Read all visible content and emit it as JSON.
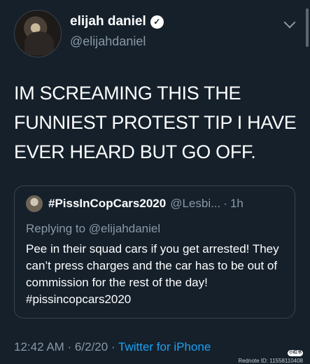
{
  "author": {
    "display_name": "elijah daniel",
    "handle": "@elijahdaniel"
  },
  "tweet": {
    "text": "IM SCREAMING THIS THE FUNNIEST PROTEST TIP I HAVE EVER HEARD BUT GO OFF."
  },
  "quoted": {
    "display_name": "#PissInCopCars2020",
    "handle": "@Lesbi...",
    "separator": "·",
    "time": "1h",
    "replying_prefix": "Replying to ",
    "replying_to": "@elijahdaniel",
    "text": "Pee in their squad cars if you get arrested! They can’t press charges and the car has to be out of commission for the rest of the day! #pissincopcars2020"
  },
  "footer": {
    "timestamp": "12:42 AM · 6/2/20 · ",
    "source": "Twitter for iPhone"
  },
  "watermark": {
    "text": "Rednote ID: 11558110408"
  },
  "colors": {
    "background": "#15202b",
    "muted": "#8899a6",
    "link": "#1da1f2",
    "border": "#38444d"
  }
}
